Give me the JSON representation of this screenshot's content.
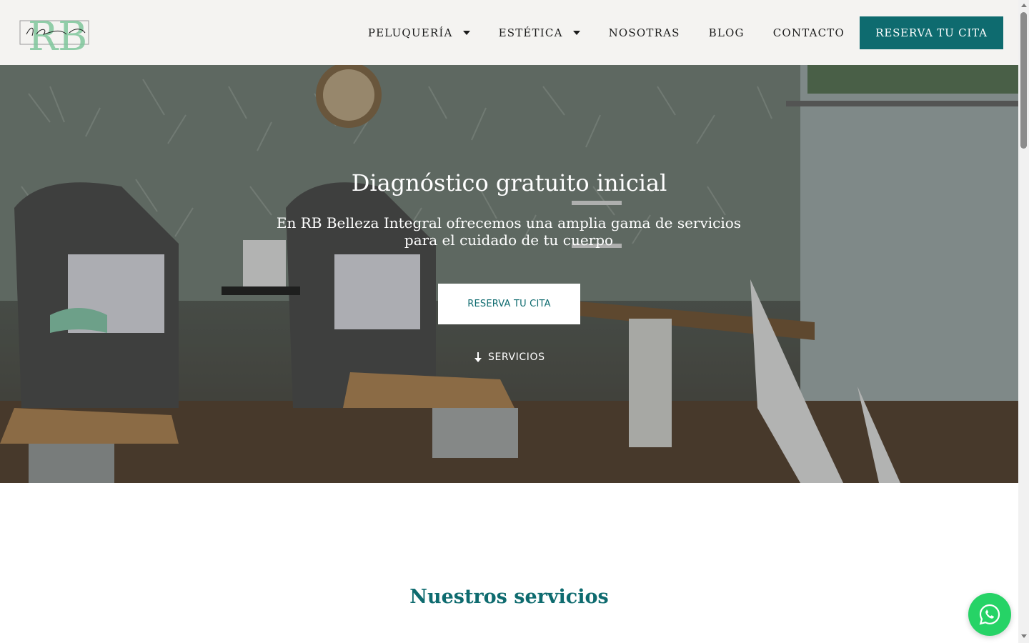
{
  "header": {
    "logo_alt": "RB",
    "nav": [
      {
        "label": "PELUQUERÍA",
        "has_dropdown": true
      },
      {
        "label": "ESTÉTICA",
        "has_dropdown": true
      },
      {
        "label": "NOSOTRAS",
        "has_dropdown": false
      },
      {
        "label": "BLOG",
        "has_dropdown": false
      },
      {
        "label": "CONTACTO",
        "has_dropdown": false
      }
    ],
    "cta_label": "RESERVA TU CITA"
  },
  "hero": {
    "title": "Diagnóstico gratuito inicial",
    "subtitle": "En RB Belleza Integral ofrecemos una amplia gama de servicios para el cuidado de tu cuerpo",
    "button_label": "RESERVA TU CITA",
    "link_label": "SERVICIOS"
  },
  "services": {
    "title": "Nuestros servicios"
  },
  "colors": {
    "accent": "#0e6b6f",
    "header_bg": "#f4f3f1",
    "whatsapp": "#26d366",
    "logo_green": "#7fc79c"
  },
  "icons": {
    "dropdown": "chevron-down-icon",
    "arrow": "arrow-down-icon",
    "whatsapp": "whatsapp-icon"
  }
}
